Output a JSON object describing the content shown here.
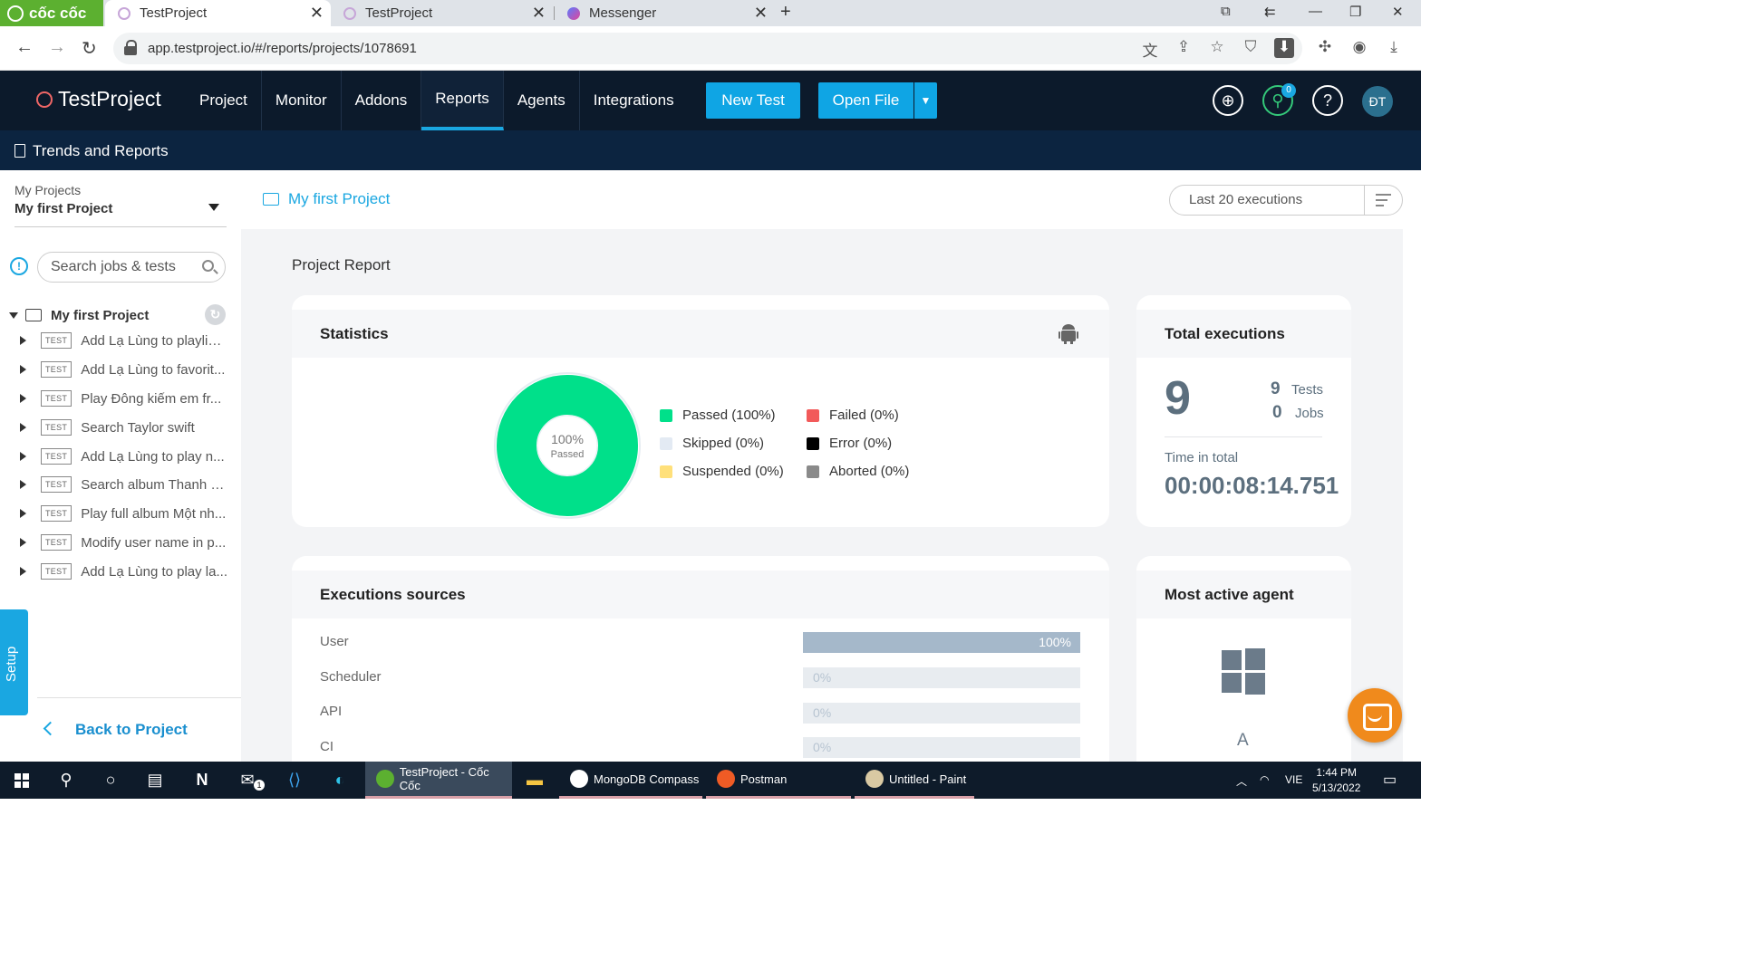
{
  "browser": {
    "brand": "cốc cốc",
    "tabs": [
      {
        "title": "TestProject",
        "active": true
      },
      {
        "title": "TestProject",
        "active": false
      },
      {
        "title": "Messenger",
        "active": false
      }
    ],
    "url": "app.testproject.io/#/reports/projects/1078691"
  },
  "app": {
    "brand": "TestProject",
    "menu": [
      "Project",
      "Monitor",
      "Addons",
      "Reports",
      "Agents",
      "Integrations"
    ],
    "active_menu": "Reports",
    "new_test_label": "New Test",
    "open_file_label": "Open File",
    "notification_count": "0",
    "user_initials": "ĐT",
    "subheader_title": "Trends and Reports",
    "accent_color": "#0fa5e4"
  },
  "sidebar": {
    "projects_label": "My Projects",
    "selected_project": "My first Project",
    "search_placeholder": "Search jobs & tests",
    "tree_root": "My first Project",
    "test_badge": "TEST",
    "tests": [
      "Add Lạ Lùng to playlist...",
      "Add Lạ Lùng to favorit...",
      "Play Đông kiếm em fr...",
      "Search Taylor swift",
      "Add Lạ Lùng to play n...",
      "Search album Thanh X...",
      "Play full album Một nh...",
      "Modify user name in p...",
      "Add Lạ Lùng to play la..."
    ],
    "setup_label": "Setup",
    "back_label": "Back to Project"
  },
  "main": {
    "breadcrumb": "My first Project",
    "filter_label": "Last 20 executions",
    "report_title": "Project Report",
    "statistics": {
      "title": "Statistics",
      "donut_percent": "100%",
      "donut_label": "Passed",
      "passed_fraction": 1.0,
      "legend": [
        {
          "label": "Passed (100%)",
          "color": "#00e08a"
        },
        {
          "label": "Skipped (0%)",
          "color": "#e3eaf3"
        },
        {
          "label": "Suspended (0%)",
          "color": "#ffe07a"
        },
        {
          "label": "Failed (0%)",
          "color": "#f25a5a"
        },
        {
          "label": "Error (0%)",
          "color": "#000000"
        },
        {
          "label": "Aborted (0%)",
          "color": "#8a8a8a"
        }
      ]
    },
    "totals": {
      "title": "Total executions",
      "total": "9",
      "tests_count": "9",
      "tests_label": "Tests",
      "jobs_count": "0",
      "jobs_label": "Jobs",
      "time_label": "Time in total",
      "time_value": "00:00:08:14.751"
    },
    "sources": {
      "title": "Executions sources",
      "rows": [
        {
          "label": "User",
          "value": "100%",
          "fraction": 1.0
        },
        {
          "label": "Scheduler",
          "value": "0%",
          "fraction": 0
        },
        {
          "label": "API",
          "value": "0%",
          "fraction": 0
        },
        {
          "label": "CI",
          "value": "0%",
          "fraction": 0
        }
      ]
    },
    "agent": {
      "title": "Most active agent",
      "name": "A"
    }
  },
  "taskbar": {
    "apps": [
      {
        "label": "TestProject - Cốc Cốc",
        "active": true
      },
      {
        "label": "MongoDB Compass",
        "active": false
      },
      {
        "label": "Postman",
        "active": false
      },
      {
        "label": "Untitled - Paint",
        "active": false
      }
    ],
    "mail_badge": "1",
    "language": "VIE",
    "time": "1:44 PM",
    "date": "5/13/2022"
  }
}
